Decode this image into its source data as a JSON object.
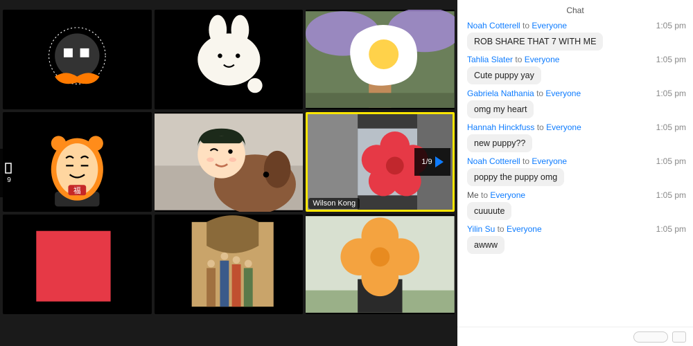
{
  "header": {
    "chat_title": "Chat"
  },
  "carousel": {
    "left_count": "9",
    "page_indicator": "1/9"
  },
  "tiles": [
    {
      "bg": "black",
      "avatar": "mustache",
      "name": ""
    },
    {
      "bg": "black",
      "avatar": "bunny",
      "name": ""
    },
    {
      "bg": "photo-jacaranda",
      "avatar": "friedegg",
      "name": ""
    },
    {
      "bg": "black",
      "avatar": "tiger",
      "name": ""
    },
    {
      "bg": "photo-dog",
      "avatar": "memoji",
      "name": ""
    },
    {
      "bg": "photo-building",
      "avatar": "redflower",
      "name": "Wilson Kong",
      "selected": true
    },
    {
      "bg": "black",
      "avatar": "redsquare",
      "name": ""
    },
    {
      "bg": "black",
      "avatar": "painting",
      "name": ""
    },
    {
      "bg": "photo-outdoor",
      "avatar": "orangeflower",
      "name": ""
    }
  ],
  "messages": [
    {
      "sender": "Noah Cotterell",
      "self": false,
      "to": "Everyone",
      "time": "1:05 pm",
      "text": "ROB SHARE THAT 7 WITH ME"
    },
    {
      "sender": "Tahlia Slater",
      "self": false,
      "to": "Everyone",
      "time": "1:05 pm",
      "text": "Cute puppy yay"
    },
    {
      "sender": "Gabriela Nathania",
      "self": false,
      "to": "Everyone",
      "time": "1:05 pm",
      "text": "omg my heart"
    },
    {
      "sender": "Hannah Hinckfuss",
      "self": false,
      "to": "Everyone",
      "time": "1:05 pm",
      "text": "new puppy??"
    },
    {
      "sender": "Noah Cotterell",
      "self": false,
      "to": "Everyone",
      "time": "1:05 pm",
      "text": "poppy the puppy omg"
    },
    {
      "sender": "Me",
      "self": true,
      "to": "Everyone",
      "time": "1:05 pm",
      "text": "cuuuute"
    },
    {
      "sender": "Yilin Su",
      "self": false,
      "to": "Everyone",
      "time": "1:05 pm",
      "text": "awww"
    }
  ],
  "strings": {
    "to": "to"
  }
}
